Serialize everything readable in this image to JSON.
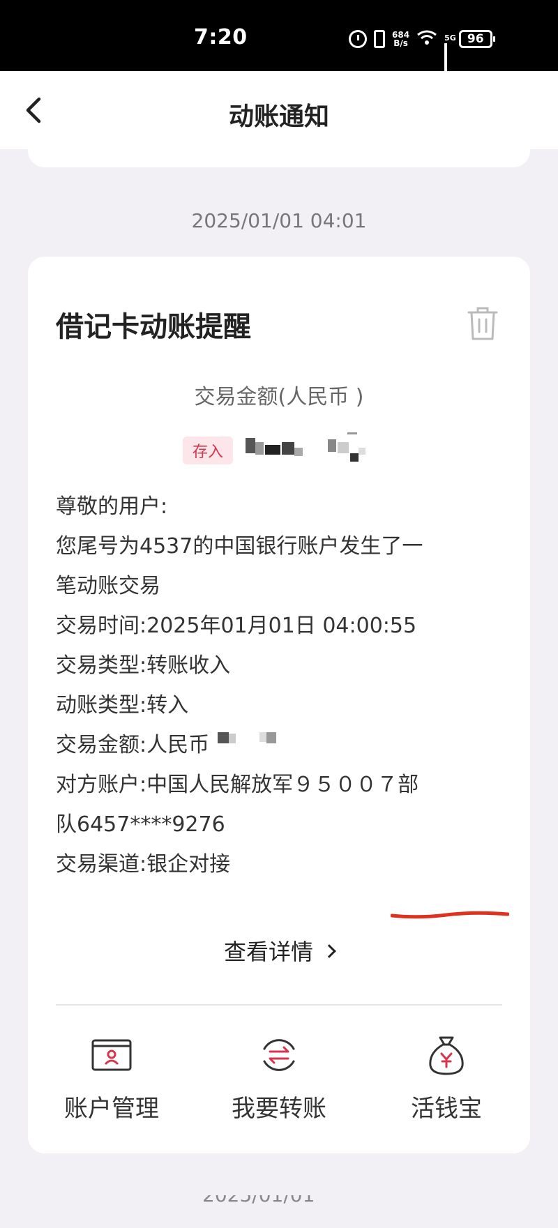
{
  "status_bar": {
    "time": "7:20",
    "net_speed_value": "684",
    "net_speed_unit": "B/s",
    "network": "5G",
    "battery": "96",
    "icons": [
      "alarm-icon",
      "vibrate-icon",
      "wifi-icon",
      "signal-icon",
      "battery-icon"
    ]
  },
  "header": {
    "title": "动账通知",
    "back_icon": "chevron-left-icon"
  },
  "date_separator": "2025/01/01 04:01",
  "card": {
    "title": "借记卡动账提醒",
    "trash_icon": "trash-icon",
    "amount_label": "交易金额(人民币 )",
    "deposit_tag": "存入",
    "greeting": "尊敬的用户:",
    "message_line1": "您尾号为4537的中国银行账户发生了一",
    "message_line2": "笔动账交易",
    "fields": [
      {
        "label": "交易时间:",
        "value": "2025年01月01日 04:00:55"
      },
      {
        "label": "交易类型:",
        "value": "转账收入"
      },
      {
        "label": "动账类型:",
        "value": "转入"
      },
      {
        "label": "交易金额:",
        "value": "人民币"
      },
      {
        "label": "对方账户:",
        "value": "中国人民解放军９５００７部"
      }
    ],
    "counterparty_line2": "队6457****9276",
    "channel": {
      "label": "交易渠道:",
      "value": "银企对接"
    },
    "view_details": "查看详情",
    "actions": [
      {
        "label": "账户管理",
        "icon": "account-card-icon"
      },
      {
        "label": "我要转账",
        "icon": "transfer-icon"
      },
      {
        "label": "活钱宝",
        "icon": "money-bag-icon"
      }
    ]
  },
  "colors": {
    "accent": "#d6364d",
    "underline": "#e0301e",
    "background": "#f2f0f4"
  }
}
